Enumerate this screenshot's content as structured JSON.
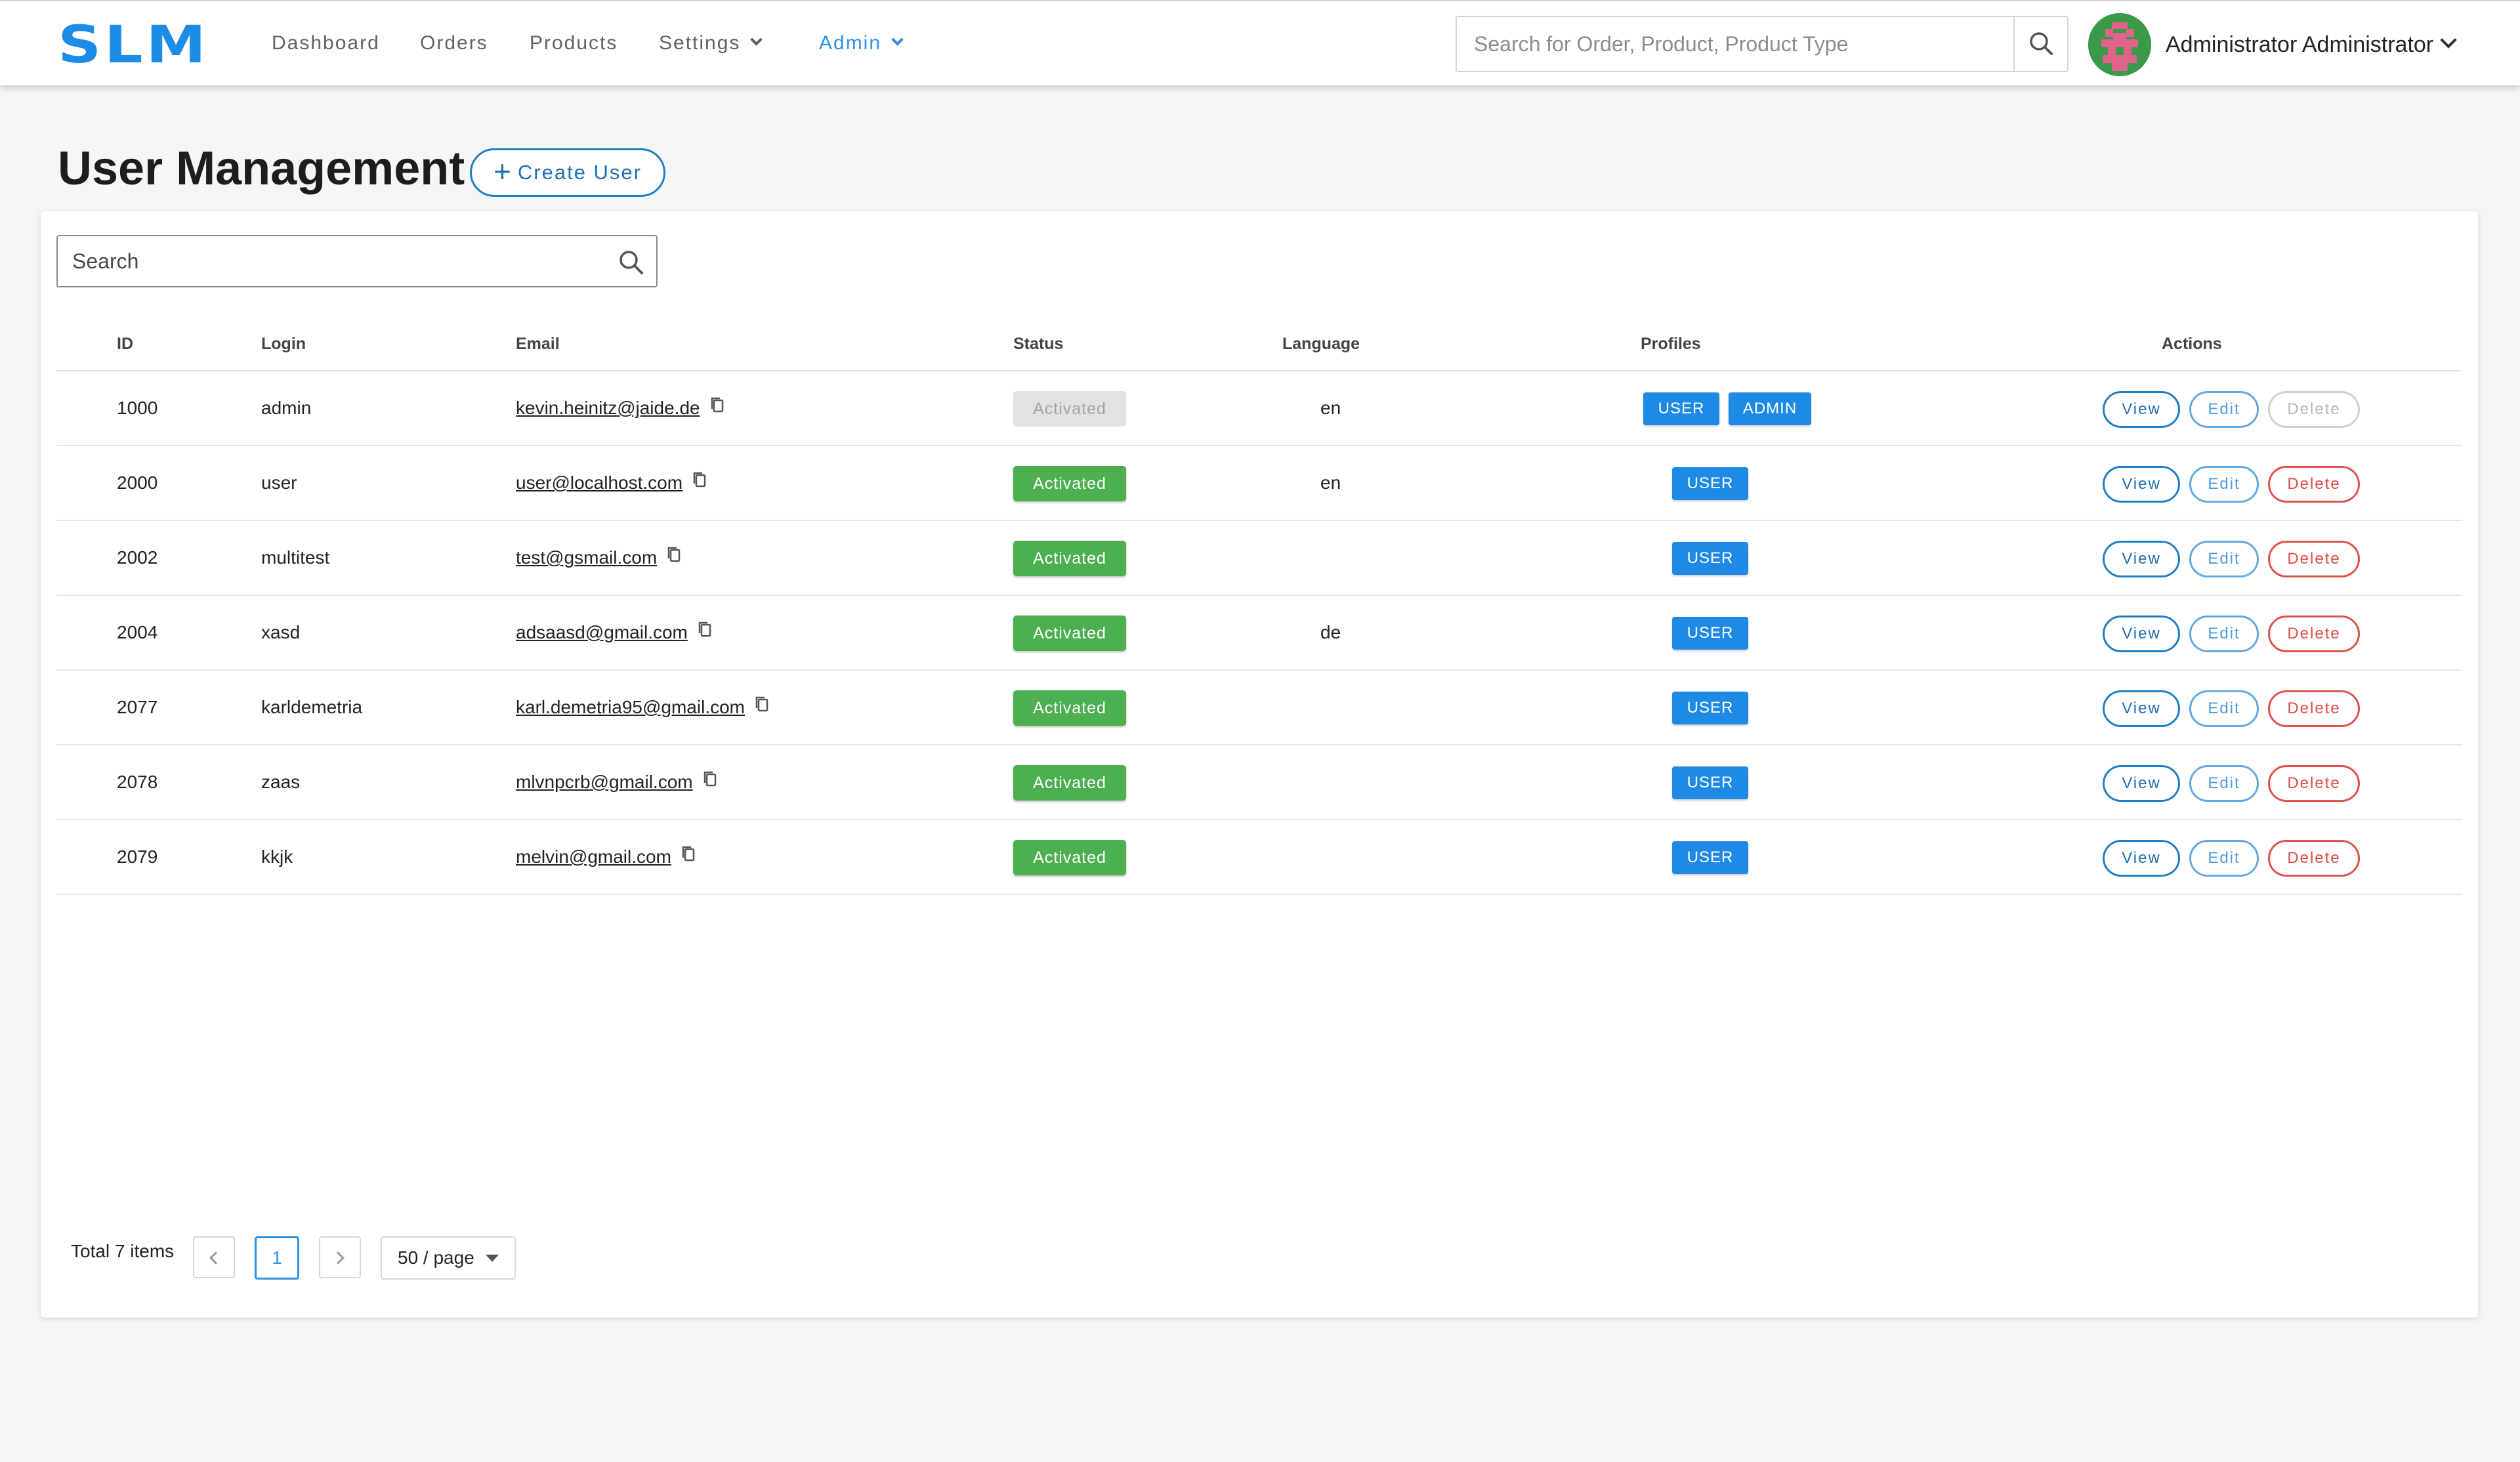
{
  "app": {
    "logo": "SLM"
  },
  "nav": {
    "dashboard": "Dashboard",
    "orders": "Orders",
    "products": "Products",
    "settings": "Settings",
    "admin": "Admin"
  },
  "header_search": {
    "placeholder": "Search for Order, Product, Product Type"
  },
  "user": {
    "name": "Administrator Administrator"
  },
  "page": {
    "title": "User Management",
    "create_label": "Create User"
  },
  "table_search": {
    "placeholder": "Search"
  },
  "columns": {
    "id": "ID",
    "login": "Login",
    "email": "Email",
    "status": "Status",
    "language": "Language",
    "profiles": "Profiles",
    "actions": "Actions"
  },
  "actions": {
    "view": "View",
    "edit": "Edit",
    "delete": "Delete"
  },
  "rows": [
    {
      "id": "1000",
      "login": "admin",
      "email": "kevin.heinitz@jaide.de",
      "status": "Activated",
      "status_disabled": true,
      "language": "en",
      "profiles": [
        "USER",
        "ADMIN"
      ],
      "delete_disabled": true
    },
    {
      "id": "2000",
      "login": "user",
      "email": "user@localhost.com",
      "status": "Activated",
      "status_disabled": false,
      "language": "en",
      "profiles": [
        "USER"
      ],
      "delete_disabled": false
    },
    {
      "id": "2002",
      "login": "multitest",
      "email": "test@gsmail.com",
      "status": "Activated",
      "status_disabled": false,
      "language": "",
      "profiles": [
        "USER"
      ],
      "delete_disabled": false
    },
    {
      "id": "2004",
      "login": "xasd",
      "email": "adsaasd@gmail.com",
      "status": "Activated",
      "status_disabled": false,
      "language": "de",
      "profiles": [
        "USER"
      ],
      "delete_disabled": false
    },
    {
      "id": "2077",
      "login": "karldemetria",
      "email": "karl.demetria95@gmail.com",
      "status": "Activated",
      "status_disabled": false,
      "language": "",
      "profiles": [
        "USER"
      ],
      "delete_disabled": false
    },
    {
      "id": "2078",
      "login": "zaas",
      "email": "mlvnpcrb@gmail.com",
      "status": "Activated",
      "status_disabled": false,
      "language": "",
      "profiles": [
        "USER"
      ],
      "delete_disabled": false
    },
    {
      "id": "2079",
      "login": "kkjk",
      "email": "melvin@gmail.com",
      "status": "Activated",
      "status_disabled": false,
      "language": "",
      "profiles": [
        "USER"
      ],
      "delete_disabled": false
    }
  ],
  "pagination": {
    "total_label": "Total 7 items",
    "current_page": "1",
    "page_size": "50 / page"
  },
  "icons": {
    "search": "search-icon",
    "copy": "copy-icon",
    "chevron": "chevron-down-icon",
    "prev": "chevron-left-icon",
    "next": "chevron-right-icon",
    "plus": "plus-icon",
    "avatar": "avatar-icon"
  },
  "colors": {
    "brand": "#1c8ce8",
    "active_nav": "#2e8fe6",
    "status_active": "#4caf50",
    "status_disabled": "#e2e2e2",
    "profile": "#1f8ae6",
    "view": "#1f7ec8",
    "edit": "#62a9e3",
    "delete": "#e0514b",
    "avatar_bg": "#3a9a4a",
    "avatar_pattern": "#e2628a"
  }
}
